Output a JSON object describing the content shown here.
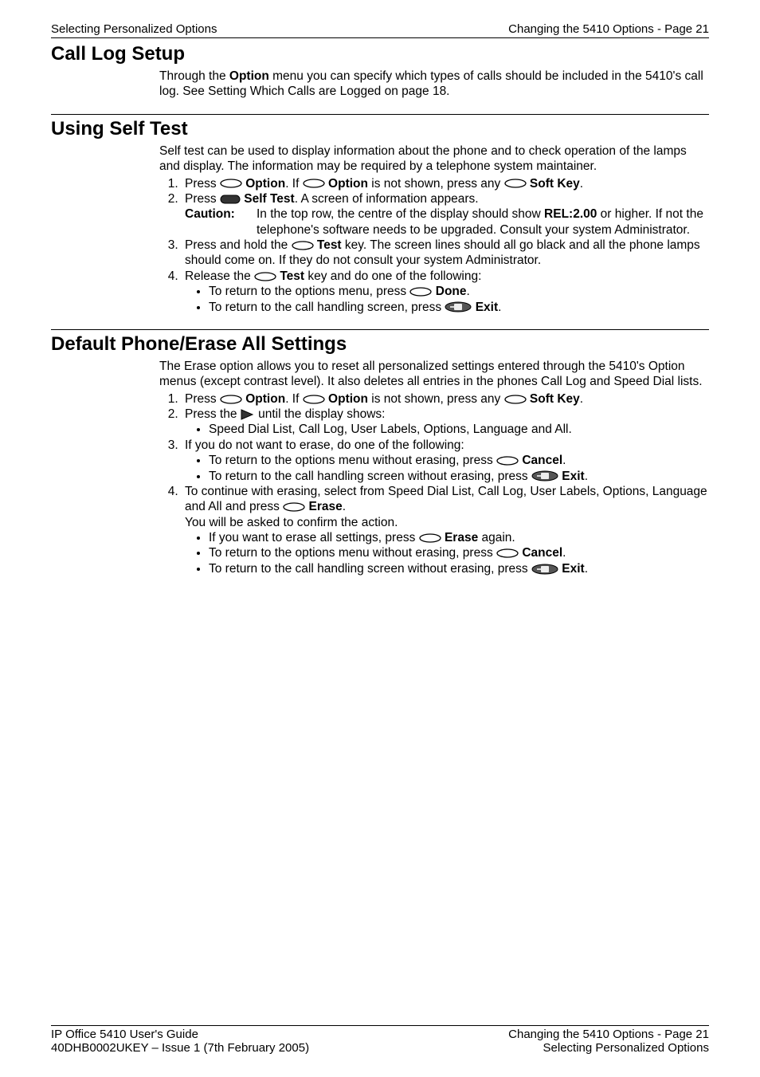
{
  "header": {
    "left": "Selecting Personalized Options",
    "right": "Changing the 5410 Options - Page 21"
  },
  "s1": {
    "title": "Call Log Setup",
    "p1a": "Through the ",
    "p1b": "Option",
    "p1c": " menu you can specify which types of calls should be included in the 5410's call log. See Setting Which Calls are Logged on page 18."
  },
  "s2": {
    "title": "Using Self Test",
    "intro": "Self test can be used to display information about the phone and to check operation of the lamps and display. The information may be required by a telephone system maintainer.",
    "step1_a": "Press ",
    "step1_b": "Option",
    "step1_c": ". If ",
    "step1_d": "Option",
    "step1_e": " is not shown, press any ",
    "step1_f": "Soft Key",
    "step1_g": ".",
    "step2_a": "Press ",
    "step2_b": "Self Test",
    "step2_c": ". A screen of information appears.",
    "caution_label": "Caution:",
    "caution_a": "In the top row, the centre of the display should show ",
    "caution_b": "REL:2.00",
    "caution_c": " or higher. If not the telephone's software needs to be upgraded. Consult your system Administrator.",
    "step3_a": "Press and hold the ",
    "step3_b": "Test",
    "step3_c": " key. The screen lines should all go black and all the phone lamps should come on. If they do not consult your system Administrator.",
    "step4_a": "Release the ",
    "step4_b": "Test",
    "step4_c": " key and do one of the following:",
    "b1_a": "To return to the options menu, press ",
    "b1_b": "Done",
    "b1_c": ".",
    "b2_a": "To return to the call handling screen, press ",
    "b2_b": "Exit",
    "b2_c": "."
  },
  "s3": {
    "title": "Default Phone/Erase All Settings",
    "intro": "The Erase option allows you to reset all personalized settings entered through the 5410's Option menus (except contrast level). It also deletes all entries in the phones Call Log and Speed Dial lists.",
    "step1_a": "Press ",
    "step1_b": "Option",
    "step1_c": ". If ",
    "step1_d": "Option",
    "step1_e": " is not shown, press any ",
    "step1_f": "Soft Key",
    "step1_g": ".",
    "step2_a": "Press the ",
    "step2_b": " until the display shows:",
    "step2_bul": "Speed Dial List, Call Log, User Labels, Options, Language and All.",
    "step3": "If you do not want to erase, do one of the following:",
    "step3_b1_a": "To return to the options menu without erasing, press ",
    "step3_b1_b": "Cancel",
    "step3_b1_c": ".",
    "step3_b2_a": "To return to the call handling screen without erasing, press ",
    "step3_b2_b": "Exit",
    "step3_b2_c": ".",
    "step4_a": "To continue with erasing, select from Speed Dial List, Call Log, User Labels, Options, Language and All and press ",
    "step4_b": "Erase",
    "step4_c": ".",
    "step4_d": "You will be asked to confirm the action.",
    "step4_b1_a": "If you want to erase all settings, press ",
    "step4_b1_b": "Erase",
    "step4_b1_c": " again.",
    "step4_b2_a": "To return to the options menu without erasing, press ",
    "step4_b2_b": "Cancel",
    "step4_b2_c": ".",
    "step4_b3_a": "To return to the call handling screen without erasing, press ",
    "step4_b3_b": "Exit",
    "step4_b3_c": "."
  },
  "footer": {
    "l1_left": "IP Office 5410 User's Guide",
    "l1_right": "Changing the 5410 Options - Page 21",
    "l2_left": "40DHB0002UKEY – Issue 1 (7th February 2005)",
    "l2_right": "Selecting Personalized Options"
  }
}
